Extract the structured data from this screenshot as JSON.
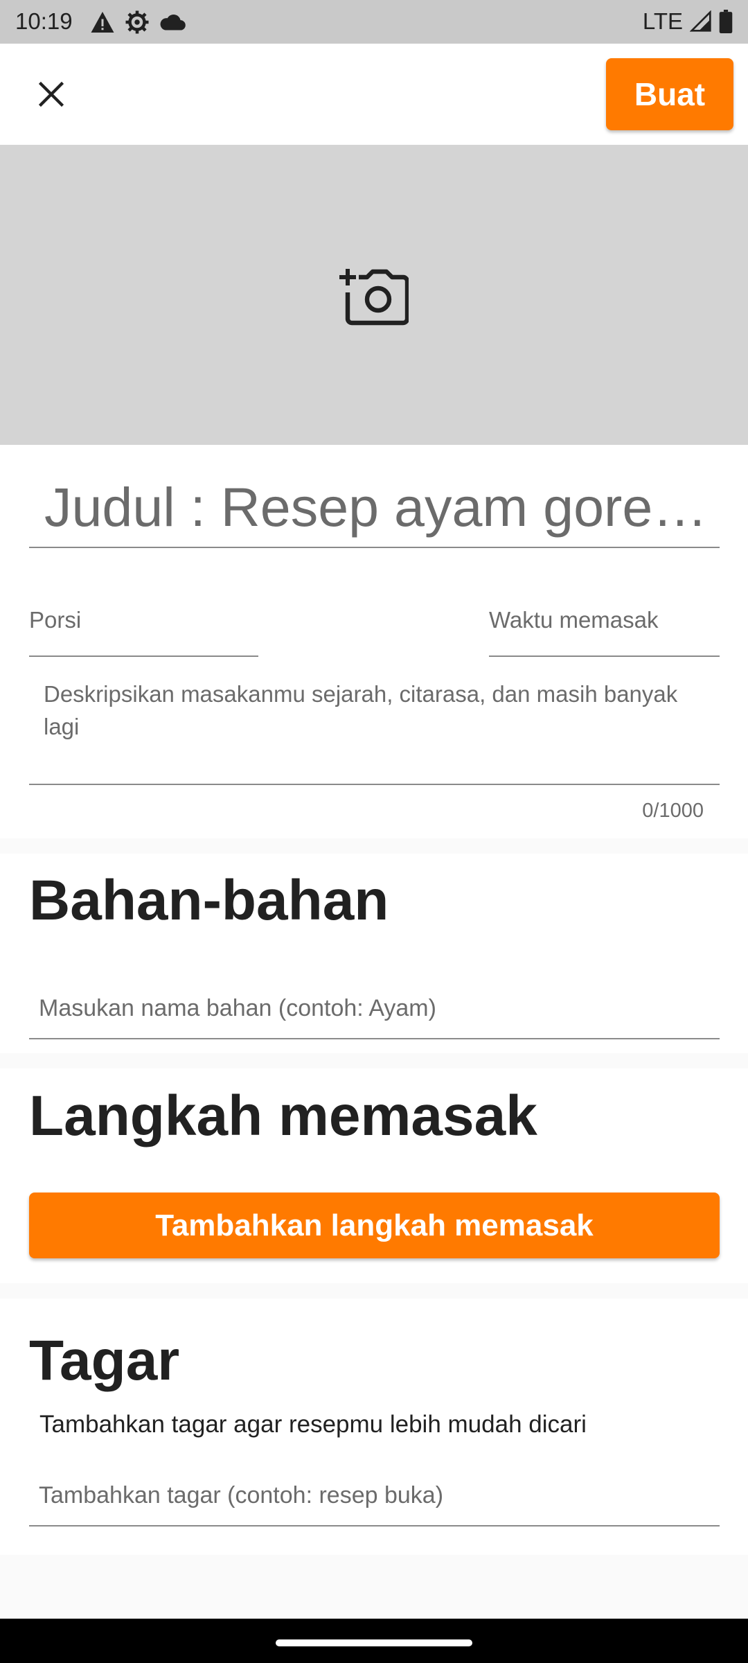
{
  "status_bar": {
    "time": "10:19",
    "network": "LTE",
    "icons_left": [
      "alert-icon",
      "settings-icon",
      "cloud-icon"
    ],
    "icons_right": [
      "signal-icon",
      "battery-icon"
    ]
  },
  "app_bar": {
    "close_icon": "close-icon",
    "create_label": "Buat"
  },
  "photo": {
    "icon": "add-photo-icon"
  },
  "form": {
    "title_value": "Judul : Resep ayam goreng",
    "porsi_label": "Porsi",
    "waktu_label": "Waktu memasak",
    "description_placeholder": "Deskripsikan masakanmu sejarah, citarasa, dan masih banyak lagi",
    "description_counter": "0/1000"
  },
  "ingredients": {
    "heading": "Bahan-bahan",
    "placeholder": "Masukan nama bahan (contoh: Ayam)"
  },
  "steps": {
    "heading": "Langkah memasak",
    "add_button": "Tambahkan langkah memasak"
  },
  "tags": {
    "heading": "Tagar",
    "hint": "Tambahkan tagar agar resepmu lebih mudah dicari",
    "placeholder": "Tambahkan tagar (contoh: resep buka)"
  },
  "colors": {
    "accent": "#ff7a00",
    "photo_background": "#d4d4d4",
    "status_bar": "#c9c9c9"
  }
}
